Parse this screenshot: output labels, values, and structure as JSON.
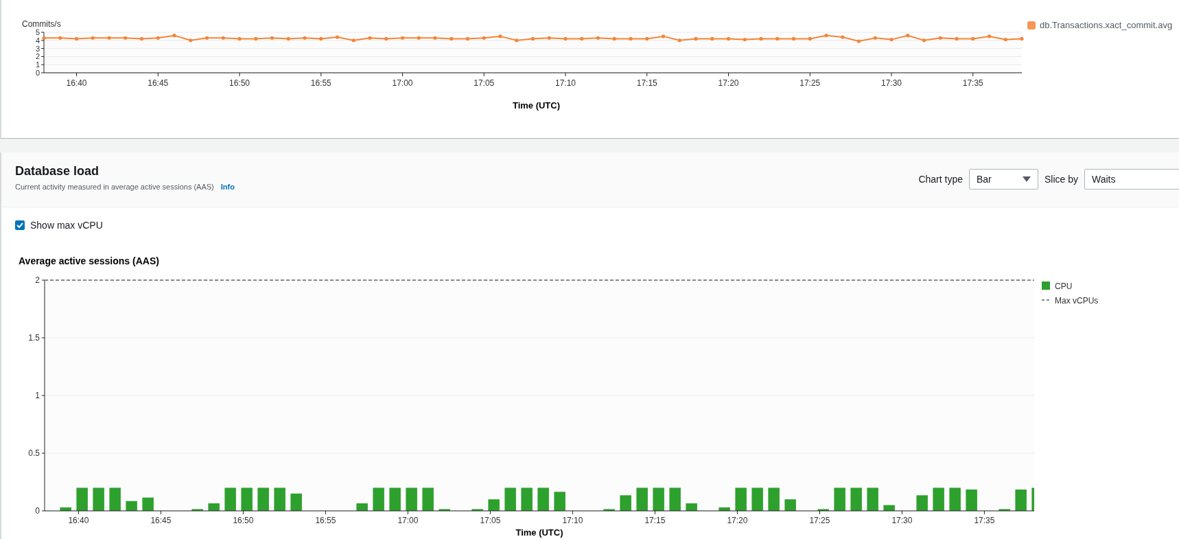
{
  "top_chart": {
    "chart_data": {
      "type": "line",
      "ylabel": "Commits/s",
      "xlabel": "Time (UTC)",
      "categories": [
        null,
        null,
        "16:40",
        null,
        null,
        null,
        null,
        "16:45",
        null,
        null,
        null,
        null,
        "16:50",
        null,
        null,
        null,
        null,
        "16:55",
        null,
        null,
        null,
        null,
        "17:00",
        null,
        null,
        null,
        null,
        "17:05",
        null,
        null,
        null,
        null,
        "17:10",
        null,
        null,
        null,
        null,
        "17:15",
        null,
        null,
        null,
        null,
        "17:20",
        null,
        null,
        null,
        null,
        "17:25",
        null,
        null,
        null,
        null,
        "17:30",
        null,
        null,
        null,
        null,
        "17:35",
        null,
        null,
        null
      ],
      "series": [
        {
          "name": "db.Transactions.xact_commit.avg",
          "color": "#f58536",
          "values": [
            4.3,
            4.3,
            4.2,
            4.3,
            4.3,
            4.3,
            4.2,
            4.3,
            4.6,
            4.0,
            4.3,
            4.3,
            4.2,
            4.2,
            4.3,
            4.2,
            4.3,
            4.2,
            4.4,
            4.0,
            4.3,
            4.2,
            4.3,
            4.3,
            4.3,
            4.2,
            4.2,
            4.3,
            4.5,
            4.0,
            4.2,
            4.3,
            4.2,
            4.2,
            4.3,
            4.2,
            4.2,
            4.2,
            4.5,
            4.0,
            4.2,
            4.2,
            4.2,
            4.1,
            4.2,
            4.2,
            4.2,
            4.2,
            4.6,
            4.4,
            3.9,
            4.3,
            4.1,
            4.6,
            4.0,
            4.3,
            4.2,
            4.2,
            4.5,
            4.1,
            4.2
          ]
        }
      ],
      "ylim": [
        0,
        5
      ],
      "yticks": [
        0,
        1,
        2,
        3,
        4,
        5
      ],
      "grid": true
    }
  },
  "database_load": {
    "title": "Database load",
    "subtitle": "Current activity measured in average active sessions (AAS)",
    "info_link": "Info",
    "chart_type": {
      "label": "Chart type",
      "value": "Bar"
    },
    "slice_by": {
      "label": "Slice by",
      "value": "Waits"
    },
    "show_max_vcpu": {
      "label": "Show max vCPU",
      "checked": true
    },
    "chart_data": {
      "type": "bar",
      "title": "Average active sessions (AAS)",
      "xlabel": "Time (UTC)",
      "categories": [
        null,
        "16:40",
        null,
        null,
        null,
        null,
        "16:45",
        null,
        null,
        null,
        null,
        "16:50",
        null,
        null,
        null,
        null,
        "16:55",
        null,
        null,
        null,
        null,
        "17:00",
        null,
        null,
        null,
        null,
        "17:05",
        null,
        null,
        null,
        null,
        "17:10",
        null,
        null,
        null,
        null,
        "17:15",
        null,
        null,
        null,
        null,
        "17:20",
        null,
        null,
        null,
        null,
        "17:25",
        null,
        null,
        null,
        null,
        "17:30",
        null,
        null,
        null,
        null,
        "17:35",
        null,
        null,
        null
      ],
      "series": [
        {
          "name": "CPU",
          "color": "#2ea02e",
          "values": [
            0.03,
            0.2,
            0.2,
            0.2,
            0.085,
            0.115,
            0,
            0,
            0.015,
            0.065,
            0.2,
            0.2,
            0.2,
            0.2,
            0.15,
            0,
            0,
            0,
            0.065,
            0.2,
            0.2,
            0.2,
            0.2,
            0.015,
            0,
            0.015,
            0.1,
            0.2,
            0.2,
            0.2,
            0.165,
            0,
            0,
            0.015,
            0.135,
            0.2,
            0.2,
            0.2,
            0.065,
            0,
            0.03,
            0.2,
            0.2,
            0.2,
            0.1,
            0,
            0.015,
            0.2,
            0.2,
            0.2,
            0.05,
            0,
            0.135,
            0.2,
            0.2,
            0.185,
            0,
            0.015,
            0.185,
            0.2
          ]
        }
      ],
      "ylim": [
        0,
        2
      ],
      "yticks": [
        0,
        0.5,
        1,
        1.5,
        2
      ],
      "grid": true,
      "ref_lines": [
        {
          "label": "Max vCPUs"
        }
      ]
    }
  }
}
